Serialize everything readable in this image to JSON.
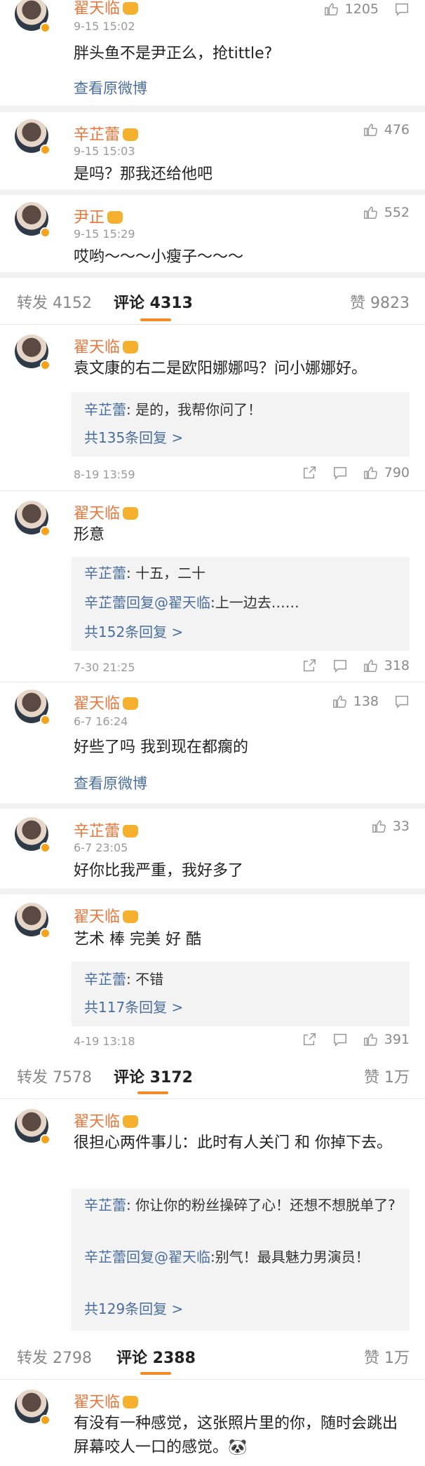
{
  "colors": {
    "accent": "#f28b24",
    "name": "#e9763a",
    "link": "#4a6ea0"
  },
  "c1": {
    "name": "翟天临",
    "time": "9-15 15:02",
    "likes": "1205",
    "content": "胖头鱼不是尹正么，抢tittle?",
    "link": "查看原微博"
  },
  "c2": {
    "name": "辛芷蕾",
    "time": "9-15 15:03",
    "likes": "476",
    "content": "是吗？那我还给他吧"
  },
  "c3": {
    "name": "尹正",
    "time": "9-15 15:29",
    "likes": "552",
    "content": "哎哟～～～小瘦子～～～"
  },
  "tabs1": {
    "repost": "转发 4152",
    "comment": "评论 4313",
    "like": "赞 9823"
  },
  "c4": {
    "name": "翟天临",
    "content": "袁文康的右二是欧阳娜娜吗？问小娜娜好。",
    "r_name": "辛芷蕾",
    "r_text": ": 是的，我帮你问了！",
    "more": "共135条回复 >",
    "time": "8-19 13:59",
    "likes": "790"
  },
  "c5": {
    "name": "翟天临",
    "content": "形意",
    "r1_name": "辛芷蕾",
    "r1_text": ": 十五，二十",
    "r2_name": "辛芷蕾回复@翟天临",
    "r2_text": ":上一边去……",
    "more": "共152条回复 >",
    "time": "7-30 21:25",
    "likes": "318"
  },
  "c6": {
    "name": "翟天临",
    "time": "6-7 16:24",
    "likes": "138",
    "content": "好些了吗 我到现在都瘸的",
    "link": "查看原微博"
  },
  "c7": {
    "name": "辛芷蕾",
    "time": "6-7 23:05",
    "likes": "33",
    "content": "好你比我严重，我好多了"
  },
  "c8": {
    "name": "翟天临",
    "content": "艺术 棒 完美 好 酷",
    "r_name": "辛芷蕾",
    "r_text": ": 不错",
    "more": "共117条回复 >",
    "time": "4-19 13:18",
    "likes": "391"
  },
  "tabs2": {
    "repost": "转发 7578",
    "comment": "评论 3172",
    "like": "赞 1万"
  },
  "c9": {
    "name": "翟天临",
    "content": "很担心两件事儿：此时有人关门 和 你掉下去。",
    "r1_name": "辛芷蕾",
    "r1_text": ": 你让你的粉丝操碎了心！还想不想脱单了?",
    "r2_name": "辛芷蕾回复@翟天临",
    "r2_text": ":别气！最具魅力男演员！",
    "more": "共129条回复 >"
  },
  "tabs3": {
    "repost": "转发 2798",
    "comment": "评论 2388",
    "like": "赞 1万"
  },
  "c10": {
    "name": "翟天临",
    "content": "有没有一种感觉，这张照片里的你，随时会跳出屏幕咬人一口的感觉。🐼"
  }
}
